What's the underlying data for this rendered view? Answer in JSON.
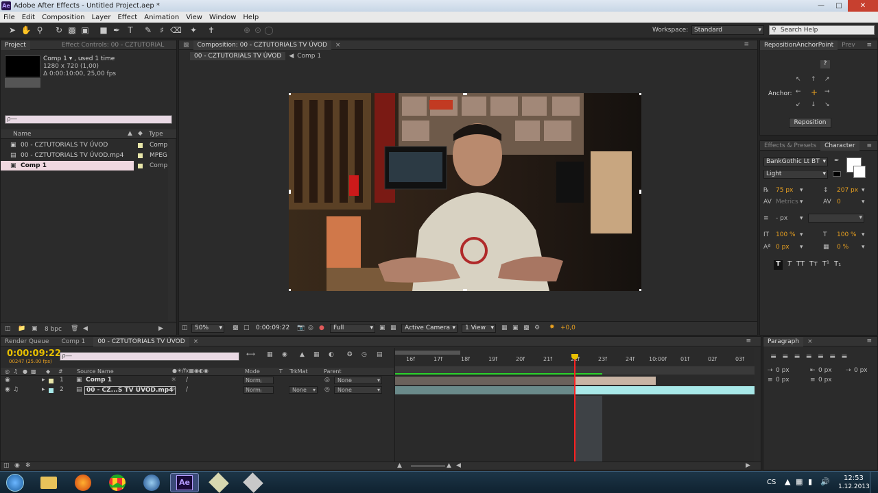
{
  "window": {
    "title": "Adobe After Effects - Untitled Project.aep *",
    "app_icon": "Ae"
  },
  "menu": [
    "File",
    "Edit",
    "Composition",
    "Layer",
    "Effect",
    "Animation",
    "View",
    "Window",
    "Help"
  ],
  "toolbar": {
    "workspace_label": "Workspace:",
    "workspace_value": "Standard",
    "search_placeholder": "Search Help"
  },
  "project": {
    "tabs": [
      "Project",
      "Effect Controls: 00 - CZTUTORIAL"
    ],
    "comp_name": "Comp 1 ▾ , used 1 time",
    "comp_size": "1280 x 720 (1,00)",
    "comp_info": "Δ 0:00:10:00, 25,00 fps",
    "search_placeholder": "ρ―",
    "col_name": "Name",
    "col_type": "Type",
    "items": [
      {
        "name": "00 - CZTUTORIALS TV ÚVOD",
        "type": "Comp"
      },
      {
        "name": "00 - CZTUTORIALS TV ÚVOD.mp4",
        "type": "MPEG"
      },
      {
        "name": "Comp 1",
        "type": "Comp"
      }
    ],
    "bpc": "8 bpc"
  },
  "composition": {
    "tab": "Composition: 00 - CZTUTORIALS TV ÚVOD",
    "breadcrumbs": [
      "00 - CZTUTORIALS TV ÚVOD",
      "Comp 1"
    ],
    "zoom": "50%",
    "timecode": "0:00:09:22",
    "resolution": "Full",
    "camera": "Active Camera",
    "view": "1 View",
    "exposure": "+0,0"
  },
  "reposition": {
    "tabs": [
      "RepositionAnchorPoint",
      "Prev"
    ],
    "help": "?",
    "anchor_label": "Anchor:",
    "button": "Reposition"
  },
  "character": {
    "tabs": [
      "Effects & Presets",
      "Character"
    ],
    "font": "BankGothic Lt BT",
    "style": "Light",
    "size": "75 px",
    "leading": "207 px",
    "kerning": "Metrics",
    "tracking": "0",
    "stroke_width": "- px",
    "vscale": "100 %",
    "hscale": "100 %",
    "baseline": "0 px",
    "tsume": "0 %",
    "format_buttons": [
      "T",
      "T",
      "TT",
      "Tт",
      "T¹",
      "T₁"
    ]
  },
  "timeline": {
    "tabs": [
      "Render Queue",
      "Comp 1",
      "00 - CZTUTORIALS TV ÚVOD"
    ],
    "timecode": "0:00:09:22",
    "frame_info": "00247 (25.00 fps)",
    "search_placeholder": "ρ―",
    "col_source": "Source Name",
    "col_mode": "Mode",
    "col_t": "T",
    "col_trkmat": "TrkMat",
    "col_parent": "Parent",
    "layers": [
      {
        "num": "1",
        "name": "Comp 1",
        "mode": "Normⱼ",
        "trkmat": "",
        "parent": "None"
      },
      {
        "num": "2",
        "name": "00 - CZ...S TV ÚVOD.mp4",
        "mode": "Normⱼ",
        "trkmat": "None",
        "parent": "None"
      }
    ],
    "ruler": [
      "16f",
      "17f",
      "18f",
      "19f",
      "20f",
      "21f",
      "22f",
      "23f",
      "24f",
      "10:00f",
      "01f",
      "02f",
      "03f"
    ]
  },
  "paragraph": {
    "tabs": [
      "Paragraph"
    ],
    "indent_left": "0 px",
    "indent_right": "0 px",
    "indent_first": "0 px",
    "space_before": "0 px",
    "space_after": "0 px"
  },
  "taskbar": {
    "lang": "CS",
    "time": "12:53",
    "date": "1.12.2013"
  },
  "colors": {
    "accent": "#e8a020",
    "timecode": "#e8c000",
    "playhead": "#ff2020",
    "layer_bar": "#a8e8e8"
  }
}
